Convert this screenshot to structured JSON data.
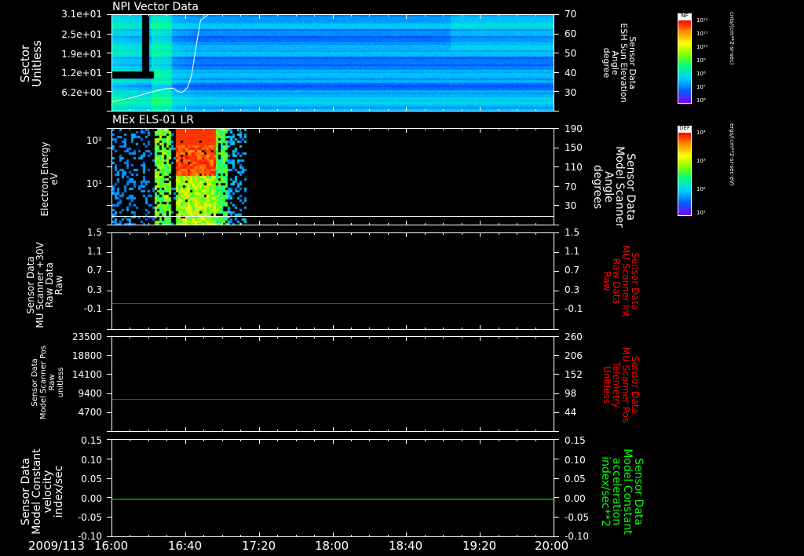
{
  "chart_data": [
    {
      "type": "heatmap",
      "title": "NPI Vector Data",
      "ylabel_left": "Sector\nUnitless",
      "yticks_left": [
        "3.1e+01",
        "2.5e+01",
        "1.9e+01",
        "1.2e+01",
        "6.2e+00"
      ],
      "ylabel_right": "Sensor Data\nESH Sun Elevation\nAngle\ndegree",
      "yticks_right": [
        "70",
        "60",
        "50",
        "40",
        "30"
      ],
      "overlay_line": {
        "name": "ESH Sun Elevation Angle",
        "color": "#ffffff",
        "x": [
          "16:00",
          "16:10",
          "16:20",
          "16:28",
          "16:33",
          "16:36",
          "16:38",
          "16:41",
          "16:43",
          "16:46",
          "16:48",
          "16:52"
        ],
        "y": [
          22,
          24,
          27,
          29,
          29.5,
          27.5,
          27,
          30,
          36,
          55,
          67,
          70
        ]
      },
      "colorbar": {
        "title": "NF",
        "unit": "cnts/(cm**2-sr-sec)",
        "ticks": [
          "10¹²",
          "10¹¹",
          "10¹⁰",
          "10⁹",
          "10⁸",
          "10⁷",
          "10⁶"
        ]
      }
    },
    {
      "type": "heatmap",
      "title": "MEx ELS-01 LR",
      "ylabel_left": "Electron Energy\neV",
      "yticks_left": [
        "10²",
        "10¹"
      ],
      "ylabel_right": "Sensor Data\nModel Scanner\nAngle\ndegrees",
      "yticks_right": [
        "190",
        "150",
        "110",
        "70",
        "30"
      ],
      "overlay_line": {
        "name": "Model Scanner Angle",
        "color": "#ffffff",
        "x": [
          "16:00",
          "20:00"
        ],
        "y": [
          10,
          10
        ]
      },
      "colorbar": {
        "title": "DEF",
        "unit": "ergs/(cm**2-sr-sec-eV)",
        "ticks": [
          "10⁴",
          "10³",
          "10²",
          "10¹"
        ]
      }
    },
    {
      "type": "line",
      "ylabel_left": "Sensor Data\nMU Scanner +30V\nRaw Data\nRaw",
      "yticks_left": [
        "1.5",
        "1.1",
        "0.7",
        "0.3",
        "-0.1"
      ],
      "ylim_left": [
        -0.4,
        1.5
      ],
      "ylabel_right": "Sensor Data\nMU Scanner Int\nRaw Data\nRaw",
      "yticks_right": [
        "1.5",
        "1.1",
        "0.7",
        "0.3",
        "-0.1"
      ],
      "series": [
        {
          "name": "MU Scanner Int Raw Data",
          "color": "#ff0000",
          "x": [
            "16:00",
            "20:00"
          ],
          "values": [
            0,
            0
          ]
        }
      ]
    },
    {
      "type": "line",
      "ylabel_left": "Sensor Data\nModel Scanner Pos\nRaw\nunitless",
      "yticks_left": [
        "23500",
        "18800",
        "14100",
        "9400",
        "4700"
      ],
      "ylim_left": [
        0,
        23500
      ],
      "ylabel_right": "Sensor Data\nMU Scanner Pos\nTelemetry\nUnitless",
      "yticks_right": [
        "260",
        "206",
        "152",
        "98",
        "44"
      ],
      "series": [
        {
          "name": "MU Scanner Pos Telemetry",
          "color": "#ff0000",
          "x": [
            "16:00",
            "20:00"
          ],
          "values": [
            8100,
            8100
          ]
        }
      ]
    },
    {
      "type": "line",
      "ylabel_left": "Sensor Data\nModel Constant\nvelocity\nindex/sec",
      "yticks_left": [
        "0.15",
        "0.10",
        "0.05",
        "0.00",
        "-0.05",
        "-0.10"
      ],
      "ylim_left": [
        -0.1,
        0.15
      ],
      "ylabel_right": "Sensor Data\nModel Constant\nacceleration\nindex/sec**2",
      "yticks_right": [
        "0.15",
        "0.10",
        "0.05",
        "0.00",
        "-0.05",
        "-0.10"
      ],
      "series": [
        {
          "name": "Model Constant acceleration",
          "color": "#00ff00",
          "x": [
            "16:00",
            "20:00"
          ],
          "values": [
            0,
            0
          ]
        }
      ]
    }
  ],
  "x_axis": {
    "date": "2009/113",
    "ticks": [
      "16:00",
      "16:40",
      "17:20",
      "18:00",
      "18:40",
      "19:20",
      "20:00"
    ]
  },
  "colors": {
    "red": "#ff0000",
    "green": "#00ff00",
    "white": "#ffffff",
    "background": "#000000"
  }
}
